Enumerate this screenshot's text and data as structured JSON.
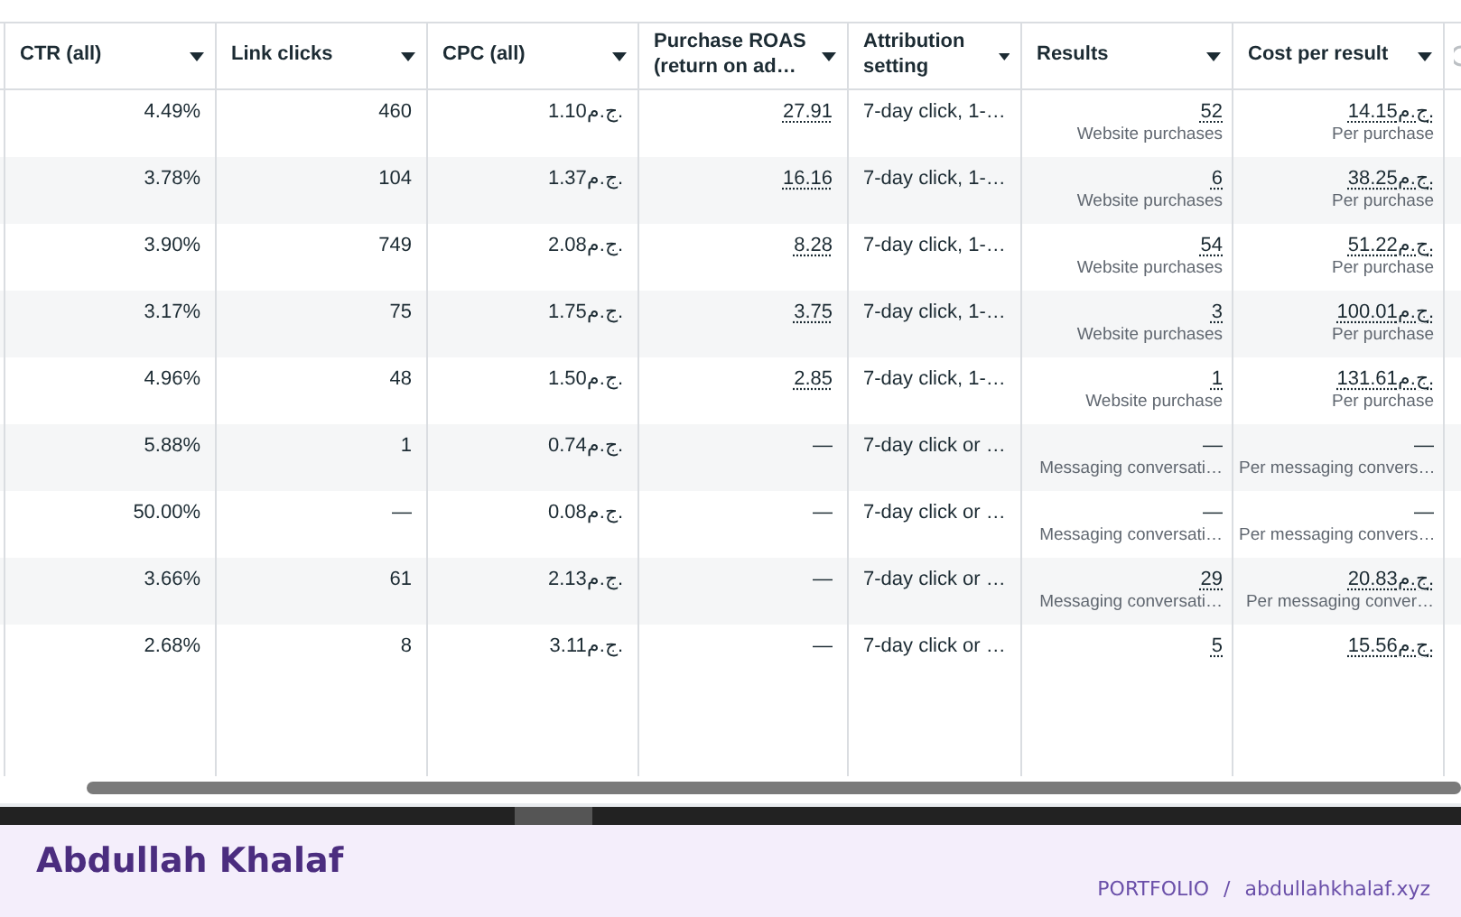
{
  "columns": [
    {
      "label": "CTR (all)"
    },
    {
      "label": "Link clicks"
    },
    {
      "label": "CPC (all)"
    },
    {
      "label": "Purchase ROAS (return on ad…"
    },
    {
      "label": "Attribution setting"
    },
    {
      "label": "Results"
    },
    {
      "label": "Cost per result"
    }
  ],
  "rows": [
    {
      "ctr": "4.49%",
      "link_clicks": "460",
      "cpc": "1.10ج.م.",
      "roas": {
        "text": "27.91",
        "dotted": true
      },
      "attribution": "7-day click, 1-…",
      "results": {
        "text": "52",
        "dotted": true,
        "label": "Website purchases"
      },
      "cost": {
        "text": "14.15ج.م.",
        "dotted": true,
        "label": "Per purchase"
      }
    },
    {
      "ctr": "3.78%",
      "link_clicks": "104",
      "cpc": "1.37ج.م.",
      "roas": {
        "text": "16.16",
        "dotted": true
      },
      "attribution": "7-day click, 1-…",
      "results": {
        "text": "6",
        "dotted": true,
        "label": "Website purchases"
      },
      "cost": {
        "text": "38.25ج.م.",
        "dotted": true,
        "label": "Per purchase"
      }
    },
    {
      "ctr": "3.90%",
      "link_clicks": "749",
      "cpc": "2.08ج.م.",
      "roas": {
        "text": "8.28",
        "dotted": true
      },
      "attribution": "7-day click, 1-…",
      "results": {
        "text": "54",
        "dotted": true,
        "label": "Website purchases"
      },
      "cost": {
        "text": "51.22ج.م.",
        "dotted": true,
        "label": "Per purchase"
      }
    },
    {
      "ctr": "3.17%",
      "link_clicks": "75",
      "cpc": "1.75ج.م.",
      "roas": {
        "text": "3.75",
        "dotted": true
      },
      "attribution": "7-day click, 1-…",
      "results": {
        "text": "3",
        "dotted": true,
        "label": "Website purchases"
      },
      "cost": {
        "text": "100.01ج.م.",
        "dotted": true,
        "label": "Per purchase"
      }
    },
    {
      "ctr": "4.96%",
      "link_clicks": "48",
      "cpc": "1.50ج.م.",
      "roas": {
        "text": "2.85",
        "dotted": true
      },
      "attribution": "7-day click, 1-…",
      "results": {
        "text": "1",
        "dotted": true,
        "label": "Website purchase"
      },
      "cost": {
        "text": "131.61ج.م.",
        "dotted": true,
        "label": "Per purchase"
      }
    },
    {
      "ctr": "5.88%",
      "link_clicks": "1",
      "cpc": "0.74ج.م.",
      "roas": {
        "text": "—",
        "dotted": false
      },
      "attribution": "7-day click or …",
      "results": {
        "text": "—",
        "dotted": false,
        "label": "Messaging conversati…"
      },
      "cost": {
        "text": "—",
        "dotted": false,
        "label": "Per messaging convers…"
      }
    },
    {
      "ctr": "50.00%",
      "link_clicks": "—",
      "cpc": "0.08ج.م.",
      "roas": {
        "text": "—",
        "dotted": false
      },
      "attribution": "7-day click or …",
      "results": {
        "text": "—",
        "dotted": false,
        "label": "Messaging conversati…"
      },
      "cost": {
        "text": "—",
        "dotted": false,
        "label": "Per messaging convers…"
      }
    },
    {
      "ctr": "3.66%",
      "link_clicks": "61",
      "cpc": "2.13ج.م.",
      "roas": {
        "text": "—",
        "dotted": false
      },
      "attribution": "7-day click or …",
      "results": {
        "text": "29",
        "dotted": true,
        "label": "Messaging conversati…"
      },
      "cost": {
        "text": "20.83ج.م.",
        "dotted": true,
        "label": "Per messaging conver…"
      }
    },
    {
      "ctr": "2.68%",
      "link_clicks": "8",
      "cpc": "3.11ج.م.",
      "roas": {
        "text": "—",
        "dotted": false
      },
      "attribution": "7-day click or …",
      "results": {
        "text": "5",
        "dotted": true
      },
      "cost": {
        "text": "15.56ج.م.",
        "dotted": true
      }
    }
  ],
  "footer": {
    "name": "Abdullah Khalaf",
    "section": "PORTFOLIO",
    "separator": "/",
    "site": "abdullahkhalaf.xyz"
  }
}
